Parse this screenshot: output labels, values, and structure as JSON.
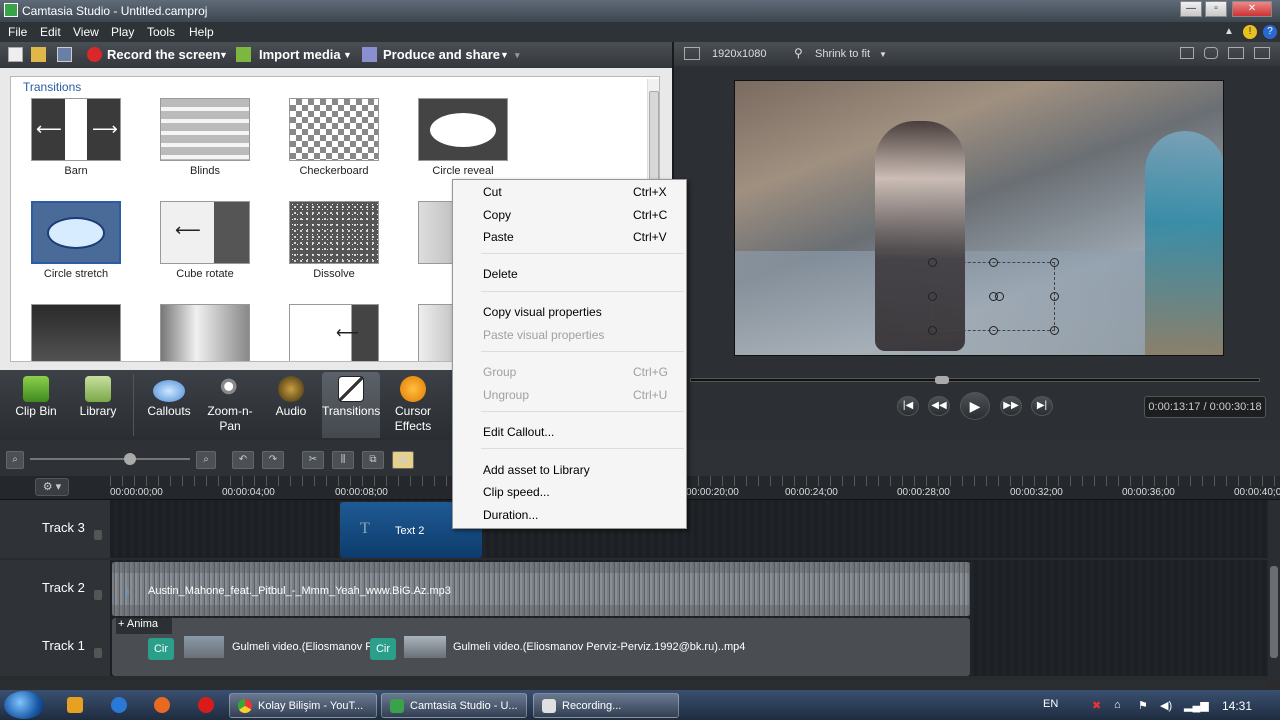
{
  "window": {
    "title": "Camtasia Studio - Untitled.camproj"
  },
  "menu": [
    "File",
    "Edit",
    "View",
    "Play",
    "Tools",
    "Help"
  ],
  "toolbar": {
    "record": "Record the screen",
    "import": "Import media",
    "produce": "Produce and share"
  },
  "preview": {
    "resolution": "1920x1080",
    "zoom": "Shrink to fit",
    "timecode": "0:00:13:17 / 0:00:30:18"
  },
  "transitions": {
    "heading": "Transitions",
    "items": [
      {
        "label": "Barn",
        "icon": "barn-transition-icon"
      },
      {
        "label": "Blinds",
        "icon": "blinds-transition-icon"
      },
      {
        "label": "Checkerboard",
        "icon": "checkerboard-transition-icon"
      },
      {
        "label": "Circle reveal",
        "icon": "circle-reveal-transition-icon"
      },
      {
        "label": "Circle stretch",
        "icon": "circle-stretch-transition-icon"
      },
      {
        "label": "Cube rotate",
        "icon": "cube-rotate-transition-icon"
      },
      {
        "label": "Dissolve",
        "icon": "dissolve-transition-icon"
      }
    ]
  },
  "tasks": [
    {
      "label": "Clip Bin",
      "icon": "clip-bin-icon"
    },
    {
      "label": "Library",
      "icon": "library-icon"
    },
    {
      "label": "Callouts",
      "icon": "callouts-icon"
    },
    {
      "label": "Zoom-n-\nPan",
      "icon": "zoom-n-pan-icon"
    },
    {
      "label": "Audio",
      "icon": "audio-icon"
    },
    {
      "label": "Transitions",
      "icon": "transitions-icon"
    },
    {
      "label": "Cursor\nEffects",
      "icon": "cursor-effects-icon"
    }
  ],
  "context_menu": {
    "cut": "Cut",
    "cut_sc": "Ctrl+X",
    "copy": "Copy",
    "copy_sc": "Ctrl+C",
    "paste": "Paste",
    "paste_sc": "Ctrl+V",
    "delete": "Delete",
    "copy_visual": "Copy visual properties",
    "paste_visual": "Paste visual properties",
    "group": "Group",
    "group_sc": "Ctrl+G",
    "ungroup": "Ungroup",
    "ungroup_sc": "Ctrl+U",
    "edit_callout": "Edit Callout...",
    "add_asset": "Add asset to Library",
    "clip_speed": "Clip speed...",
    "duration": "Duration..."
  },
  "ruler": [
    "00:00:00;00",
    "00:00:04;00",
    "00:00:08;00",
    "00:00:20;00",
    "00:00:24;00",
    "00:00:28;00",
    "00:00:32;00",
    "00:00:36;00",
    "00:00:40;00"
  ],
  "tracks": {
    "t3": {
      "name": "Track 3",
      "clip": "Text 2"
    },
    "t2": {
      "name": "Track 2",
      "clip": "Austin_Mahone_feat._Pitbul_-_Mmm_Yeah_www.BiG.Az.mp3"
    },
    "t1": {
      "name": "Track 1",
      "anim": "Anima",
      "clip_a": "Gulmeli video.(Eliosmanov P",
      "clip_b": "Gulmeli video.(Eliosmanov Perviz-Perviz.1992@bk.ru)..mp4",
      "cir": "Cir"
    }
  },
  "taskbar": {
    "task1": "Kolay Bilişim - YouT...",
    "task2": "Camtasia Studio - U...",
    "task3": "Recording...",
    "lang": "EN",
    "clock": "14:31"
  }
}
